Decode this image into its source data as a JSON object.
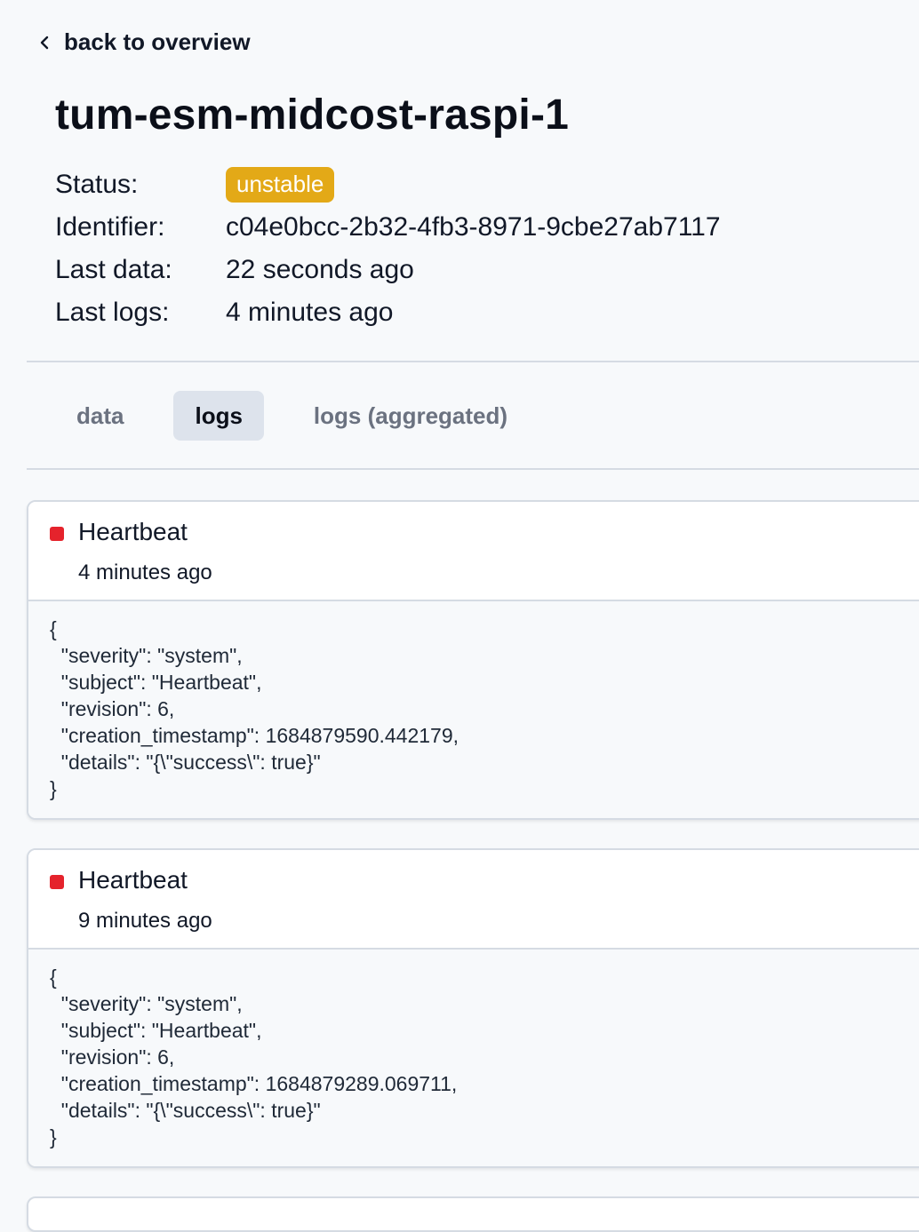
{
  "nav": {
    "back_label": "back to overview"
  },
  "device": {
    "name": "tum-esm-midcost-raspi-1",
    "fields": {
      "status_key": "Status:",
      "status_value": "unstable",
      "identifier_key": "Identifier:",
      "identifier_value": "c04e0bcc-2b32-4fb3-8971-9cbe27ab7117",
      "last_data_key": "Last data:",
      "last_data_value": "22 seconds ago",
      "last_logs_key": "Last logs:",
      "last_logs_value": "4 minutes ago"
    },
    "status_color": "#e3a917"
  },
  "tabs": [
    {
      "label": "data",
      "active": false
    },
    {
      "label": "logs",
      "active": true
    },
    {
      "label": "logs (aggregated)",
      "active": false
    }
  ],
  "logs": [
    {
      "title": "Heartbeat",
      "time": "4 minutes ago",
      "severity_color": "#e5232c",
      "body": "{\n  \"severity\": \"system\",\n  \"subject\": \"Heartbeat\",\n  \"revision\": 6,\n  \"creation_timestamp\": 1684879590.442179,\n  \"details\": \"{\\\"success\\\": true}\"\n}"
    },
    {
      "title": "Heartbeat",
      "time": "9 minutes ago",
      "severity_color": "#e5232c",
      "body": "{\n  \"severity\": \"system\",\n  \"subject\": \"Heartbeat\",\n  \"revision\": 6,\n  \"creation_timestamp\": 1684879289.069711,\n  \"details\": \"{\\\"success\\\": true}\"\n}"
    }
  ]
}
